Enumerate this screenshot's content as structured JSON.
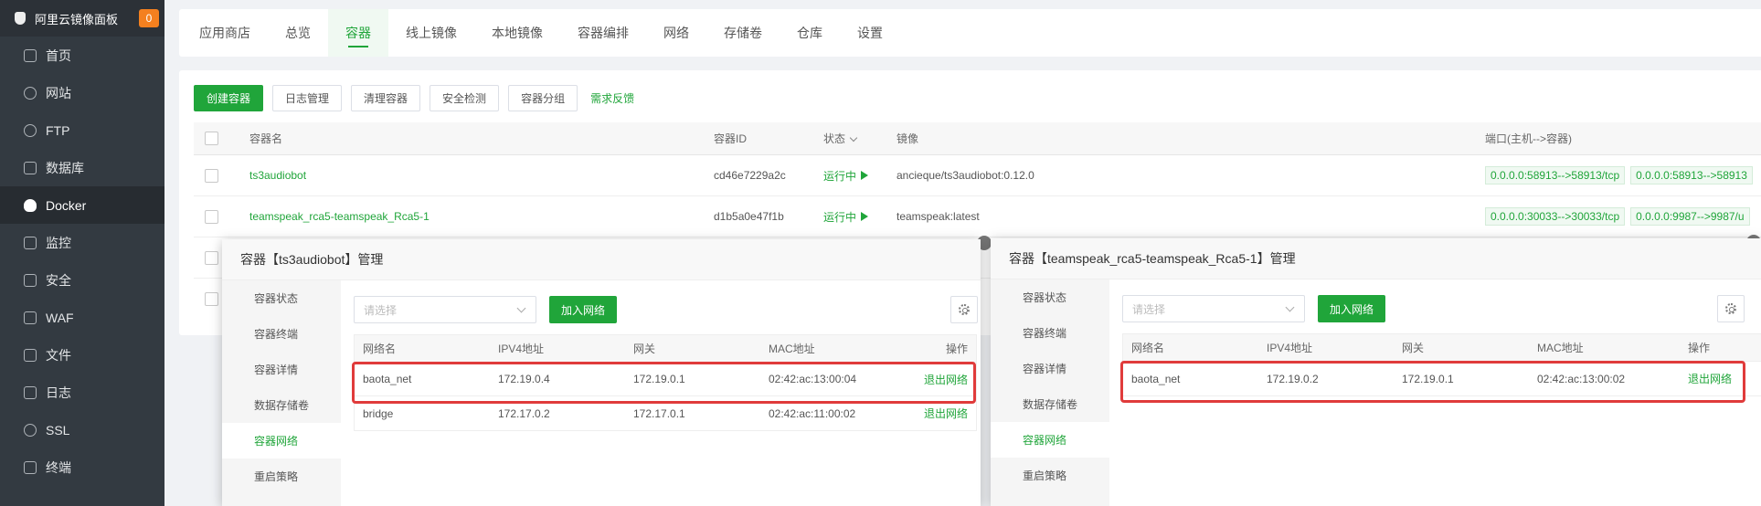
{
  "sidebar": {
    "brand": "阿里云镜像面板",
    "badge": "0",
    "items": [
      {
        "label": "首页",
        "icon": "home-icon"
      },
      {
        "label": "网站",
        "icon": "globe-icon"
      },
      {
        "label": "FTP",
        "icon": "ftp-icon"
      },
      {
        "label": "数据库",
        "icon": "database-icon"
      },
      {
        "label": "Docker",
        "icon": "docker-icon",
        "active": true
      },
      {
        "label": "监控",
        "icon": "monitor-icon"
      },
      {
        "label": "安全",
        "icon": "shield-icon"
      },
      {
        "label": "WAF",
        "icon": "waf-icon"
      },
      {
        "label": "文件",
        "icon": "folder-icon"
      },
      {
        "label": "日志",
        "icon": "log-icon"
      },
      {
        "label": "SSL",
        "icon": "ssl-icon"
      },
      {
        "label": "终端",
        "icon": "terminal-icon"
      }
    ]
  },
  "tabs": [
    "应用商店",
    "总览",
    "容器",
    "线上镜像",
    "本地镜像",
    "容器编排",
    "网络",
    "存储卷",
    "仓库",
    "设置"
  ],
  "active_tab": "容器",
  "toolbar": {
    "create": "创建容器",
    "logs": "日志管理",
    "clean": "清理容器",
    "security": "安全检测",
    "group": "容器分组",
    "feedback": "需求反馈"
  },
  "container_table": {
    "headers": {
      "name": "容器名",
      "id": "容器ID",
      "status": "状态",
      "image": "镜像",
      "ports": "端口(主机-->容器)"
    },
    "rows": [
      {
        "name": "ts3audiobot",
        "id": "cd46e7229a2c",
        "status": "运行中",
        "image": "ancieque/ts3audiobot:0.12.0",
        "ports": [
          "0.0.0.0:58913-->58913/tcp",
          "0.0.0.0:58913-->58913"
        ]
      },
      {
        "name": "teamspeak_rca5-teamspeak_Rca5-1",
        "id": "d1b5a0e47f1b",
        "status": "运行中",
        "image": "teamspeak:latest",
        "ports": [
          "0.0.0.0:30033-->30033/tcp",
          "0.0.0.0:9987-->9987/u"
        ]
      }
    ]
  },
  "dialog_left": {
    "title": "容器【ts3audiobot】管理",
    "menu": [
      "容器状态",
      "容器终端",
      "容器详情",
      "数据存储卷",
      "容器网络",
      "重启策略"
    ],
    "active_menu": "容器网络",
    "select_placeholder": "请选择",
    "add_button": "加入网络",
    "net_headers": {
      "name": "网络名",
      "ipv4": "IPV4地址",
      "gateway": "网关",
      "mac": "MAC地址",
      "action": "操作"
    },
    "networks": [
      {
        "name": "baota_net",
        "ipv4": "172.19.0.4",
        "gateway": "172.19.0.1",
        "mac": "02:42:ac:13:00:04",
        "action": "退出网络"
      },
      {
        "name": "bridge",
        "ipv4": "172.17.0.2",
        "gateway": "172.17.0.1",
        "mac": "02:42:ac:11:00:02",
        "action": "退出网络"
      }
    ]
  },
  "dialog_right": {
    "title": "容器【teamspeak_rca5-teamspeak_Rca5-1】管理",
    "menu": [
      "容器状态",
      "容器终端",
      "容器详情",
      "数据存储卷",
      "容器网络",
      "重启策略"
    ],
    "active_menu": "容器网络",
    "select_placeholder": "请选择",
    "add_button": "加入网络",
    "net_headers": {
      "name": "网络名",
      "ipv4": "IPV4地址",
      "gateway": "网关",
      "mac": "MAC地址",
      "action": "操作"
    },
    "networks": [
      {
        "name": "baota_net",
        "ipv4": "172.19.0.2",
        "gateway": "172.19.0.1",
        "mac": "02:42:ac:13:00:02",
        "action": "退出网络"
      }
    ]
  },
  "colors": {
    "accent": "#20a53a",
    "sidebar_bg": "#333a41",
    "highlight_box": "#e03b3b",
    "badge": "#f4801f"
  }
}
